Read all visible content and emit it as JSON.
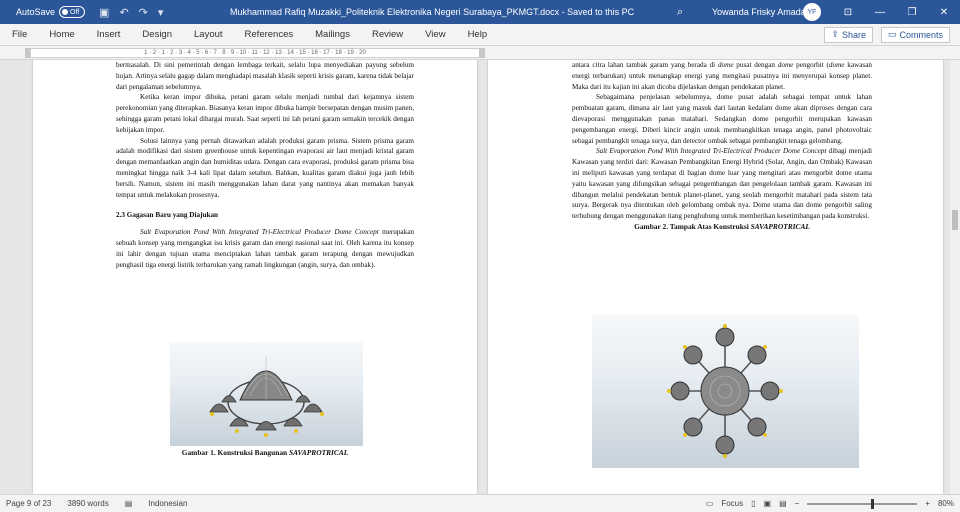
{
  "titlebar": {
    "autosave_label": "AutoSave",
    "autosave_state": "Off",
    "doc_title": "Mukhammad Rafiq Muzakki_Politeknik Elektronika Negeri Surabaya_PKMGT.docx  -  Saved to this PC",
    "user_name": "Yowanda Frisky Amada",
    "user_initials": "YF"
  },
  "ribbon": {
    "tabs": [
      "File",
      "Home",
      "Insert",
      "Design",
      "Layout",
      "References",
      "Mailings",
      "Review",
      "View",
      "Help"
    ],
    "share": "Share",
    "comments": "Comments"
  },
  "ruler": {
    "labels": "1 · 2 · 1 · 2 · 3 · 4 · 5 · 6 · 7 · 8 · 9 · 10 · 11 · 12 · 13 · 14 · 15 · 16 · 17 · 18 · 19 · 20"
  },
  "left_page": {
    "p1": "bermasalah. Di sini pemerintah dengan lembaga terkait, selalu lupa menyediakan payung sebelum hujan. Artinya selalu gagap dalam menghadapi masalah klasik seperti krisis garam, karena tidak belajar dari pengalaman sebelumnya.",
    "p2": "Ketika keran impor dibuka, petani garam selalu menjadi tumbal dari kejamnya sistem perekonomian yang diterapkan. Biasanya keran impor dibuka hampir bersepatan dengan musim panen, sehingga garam petani lokal dihargai murah. Saat seperti ini lah petani garam semakin tercekik dengan kebijakan impor.",
    "p3": "Solusi lainnya yang pernah ditawarkan adalah produksi garam prisma. Sistem prisma garam adalah modifikasi dari sistem greenhouse untuk kepentingan evaporasi air laut menjadi kristal garam dengan memanfaatkan angin dan humiditas udara. Dengan cara evaporasi, produksi garam prisma bisa meningkat hingga naik 3-4 kali lipat dalam setahun. Bahkan, kualitas garam diakui juga jauh lebih bersih. Namun, sistem ini masih menggunakan lahan darat yang nantinya akan memakan banyak tempat untuk melakukan prosesnya.",
    "heading": "2.3  Gagasan Baru yang Diajukan",
    "p4_italic": "Salt Evaporation Pond With Integrated Tri-Electrical Producer Dome Concept",
    "p4_rest": " merupakan sebuah konsep yang mengangkat isu krisis garam dan energi nasional saat ini. Oleh karena itu konsep ini lahir dengan tujuan utama menciptakan lahan tambak garam terapung dengan mewujudkan penghasil tiga energi listrik terbarukan yang ramah lingkungan (angin, surya, dan ombak).",
    "caption_prefix": "Gambar 1. Konstruksi Bangunan ",
    "caption_italic": "SAVAPROTRICAL"
  },
  "right_page": {
    "p1_a": "antara citra lahan tambak garam yang berada di ",
    "p1_dome": "dome",
    "p1_b": " pusat dengan ",
    "p1_dome2": "dome",
    "p1_c": " pengorbit (",
    "p1_dome3": "dome",
    "p1_d": " kawasan energi terbarukan) untuk menangkap energi yang mengitasi pusatnya ini menyerupai konsep planet. Maka dari itu kajian ini akan dicoba dijelaskan dengan pendekatan planet.",
    "p2": "Sebagaimana penjelasan sebelumnya, dome pusat adalah sebagai tempat untuk lahan pembuatan garam, dimana air laut yang masuk dari lautan kedalam dome akan diproses dengan cara dievaporasi menggunakan panas matahari. Sedangkan dome pengorbit merupakan kawasan pengembangan energi. Diberi kincir angin untuk membangkitkan tenaga angin, panel photovoltaic sebagai pembangkit tenaga surya, dan detector ombak sebagai pembangkit tenaga gelombang.",
    "p3_italic": "Salt Evaporation Pond With Integrated Tri-Electrical Producer Dome Concept",
    "p3_rest": " dibagi menjadi Kawasan yang terdiri dari: Kawasan Pembangkitan Energi Hybrid (Solar, Angin, dan Ombak) Kawasan ini meliputi kawasan yang terdapat di bagian dome luar yang mengitari atau mengorbit dome utama yaitu kawasan yang difungsikan sebagai pengembangan dan pengelolaan tambak garam. Kawasan ini dibangun melalui pendekatan bentuk planet-planet, yang seolah mengorbit matahari pada sistem tata surya. Bergerak nya ditentukan oleh gelombang ombak nya. Dome utama dan dome pengorbit saling terhubung dengan menggunakan tiang penghubung untuk memberikan kesetimbangan pada konstruksi.",
    "caption_prefix": "Gambar 2. Tampak Atas Konstruksi ",
    "caption_italic": "SAVAPROTRICAL"
  },
  "statusbar": {
    "page": "Page 9 of 23",
    "words": "3890 words",
    "language": "Indonesian",
    "focus": "Focus",
    "zoom": "80%"
  }
}
